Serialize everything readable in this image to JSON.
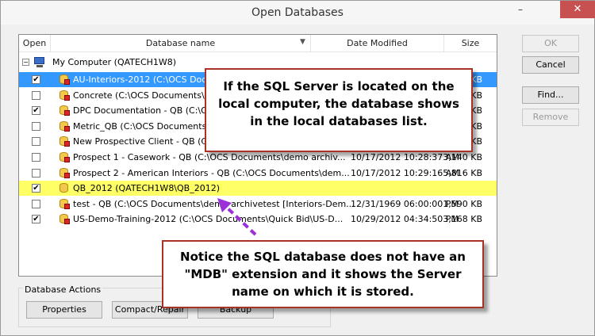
{
  "window": {
    "title": "Open Databases",
    "minimize": "–",
    "close": "✕"
  },
  "columns": {
    "open": "Open",
    "name": "Database name",
    "date": "Date Modified",
    "size": "Size"
  },
  "tree": {
    "root_label": "My Computer (QATECH1W8)"
  },
  "rows": [
    {
      "checked": true,
      "name": "AU-Interiors-2012 (C:\\OCS Docume",
      "date": "",
      "size": "KB",
      "selected": true
    },
    {
      "checked": false,
      "name": "Concrete (C:\\OCS Documents\\Qui",
      "date": "",
      "size": "KB"
    },
    {
      "checked": true,
      "name": "DPC Documentation - QB (C:\\OCS",
      "date": "",
      "size": "KB"
    },
    {
      "checked": false,
      "name": "Metric_QB (C:\\OCS Documents\\Qu",
      "date": "",
      "size": "KB"
    },
    {
      "checked": false,
      "name": "New Prospective Client - QB (C:\\",
      "date": "",
      "size": "4 KB"
    },
    {
      "checked": false,
      "name": "Prospect 1 - Casework - QB (C:\\OCS Documents\\demo archiv...",
      "date": "10/17/2012 10:28:37 AM",
      "size": "3,140 KB"
    },
    {
      "checked": false,
      "name": "Prospect 2 - American Interiors - QB (C:\\OCS Documents\\dem...",
      "date": "10/17/2012 10:29:16 AM",
      "size": "5,816 KB"
    },
    {
      "checked": true,
      "name": "QB_2012 (QATECH1W8\\QB_2012)",
      "date": "",
      "size": "",
      "highlight": true
    },
    {
      "checked": false,
      "name": "test - QB (C:\\OCS Documents\\demo archivetest [Interiors-Dem...",
      "date": "12/31/1969 06:00:00 PM",
      "size": "1,590 KB"
    },
    {
      "checked": true,
      "name": "US-Demo-Training-2012 (C:\\OCS Documents\\Quick Bid\\US-D...",
      "date": "10/29/2012 04:34:50 PM",
      "size": "3,168 KB"
    }
  ],
  "buttons": {
    "ok": "OK",
    "cancel": "Cancel",
    "find": "Find...",
    "remove": "Remove"
  },
  "actions": {
    "label": "Database Actions",
    "properties": "Properties",
    "compact": "Compact/Repair",
    "backup": "Backup"
  },
  "callouts": {
    "top": "If the SQL Server is located on the local computer, the database shows in the local databases list.",
    "bottom": "Notice the SQL database does not have an \"MDB\" extension and it shows the Server name on which it is stored."
  },
  "colors": {
    "selection": "#3399ff",
    "highlight": "#ffff66",
    "callout_border": "#a93226",
    "arrow": "#9b30d9",
    "close": "#c75050"
  }
}
